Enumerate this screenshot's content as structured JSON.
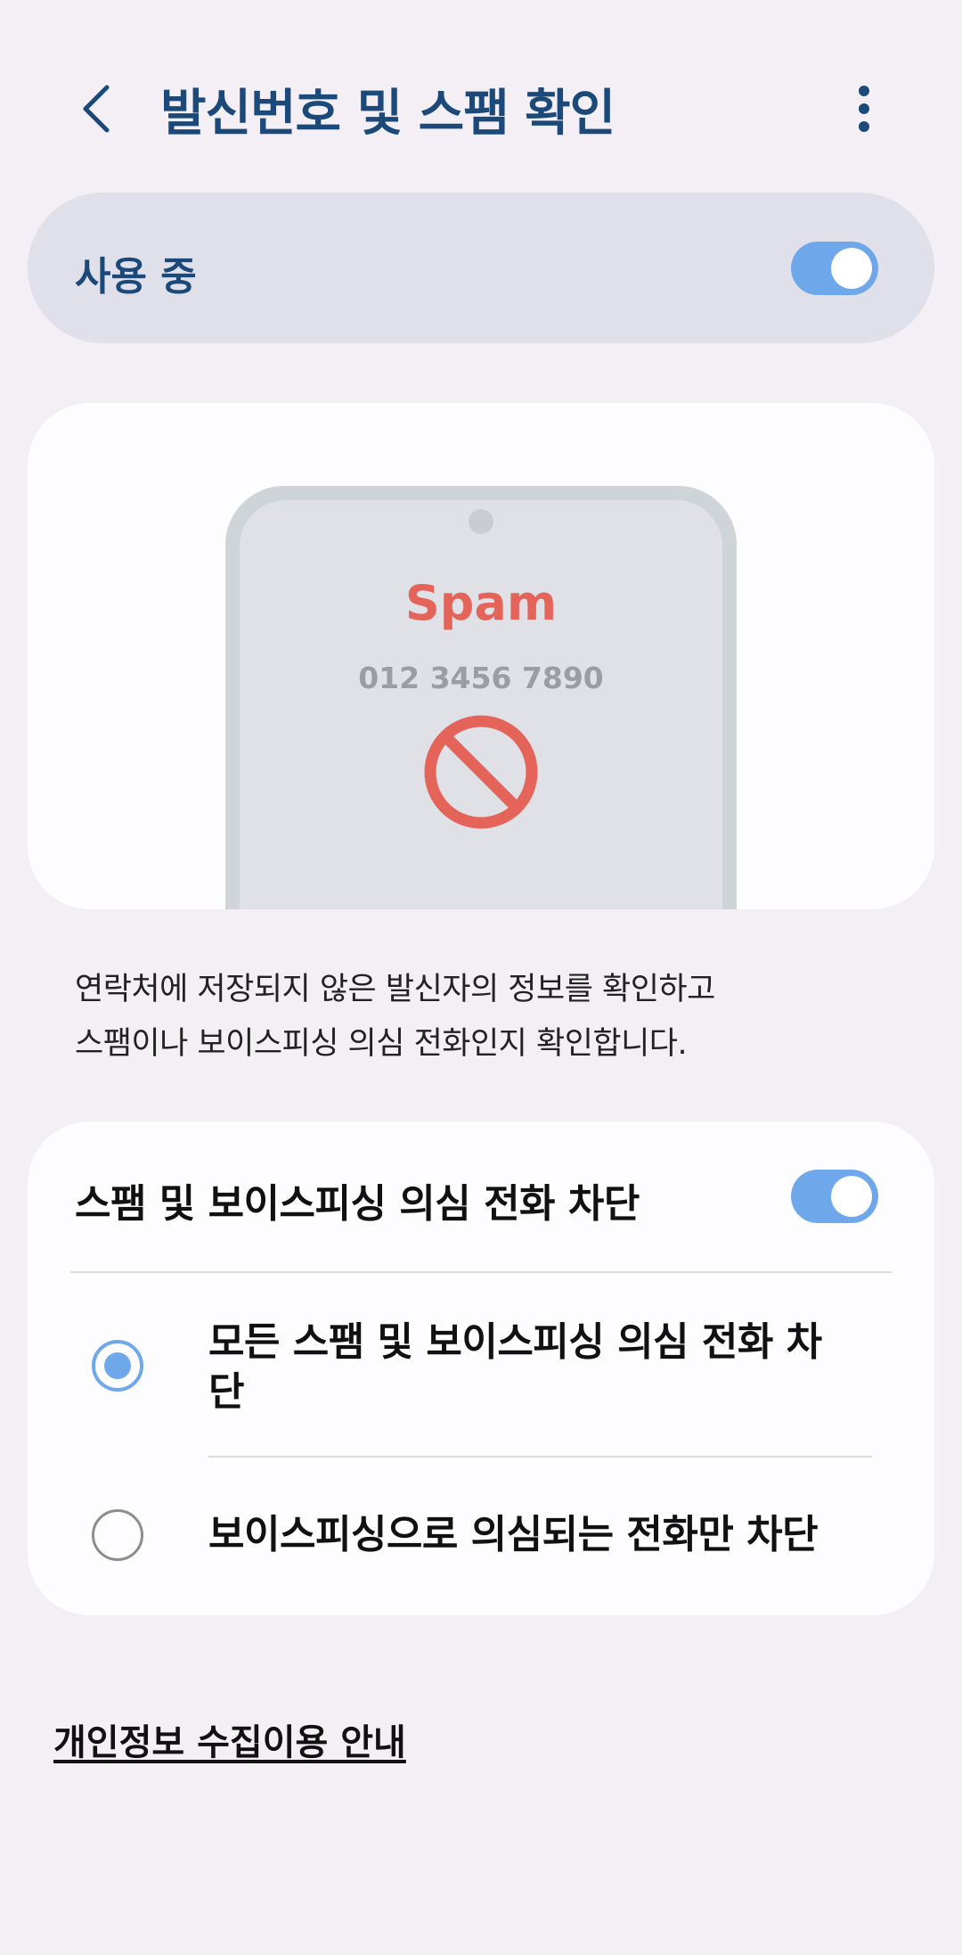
{
  "header": {
    "title": "발신번호 및 스팸 확인",
    "back_icon": "chevron-left-icon",
    "more_icon": "more-vertical-icon"
  },
  "master_toggle": {
    "label": "사용 중",
    "state": "on"
  },
  "illustration": {
    "spam_label": "Spam",
    "phone_number": "012 3456 7890",
    "icon": "block-icon"
  },
  "description": {
    "line1": "연락처에 저장되지 않은 발신자의 정보를 확인하고",
    "line2": "스팸이나 보이스피싱 의심 전화인지 확인합니다."
  },
  "block_setting": {
    "label": "스팸 및 보이스피싱 의심 전화 차단",
    "state": "on",
    "options": [
      {
        "label": "모든 스팸 및 보이스피싱 의심 전화 차단",
        "selected": true
      },
      {
        "label": "보이스피싱으로 의심되는 전화만 차단",
        "selected": false
      }
    ]
  },
  "footer": {
    "privacy_link": "개인정보 수집이용 안내"
  },
  "colors": {
    "background": "#f4eff5",
    "title": "#1b4a7a",
    "accent": "#6fa8ea",
    "spam_red": "#e5645a"
  }
}
